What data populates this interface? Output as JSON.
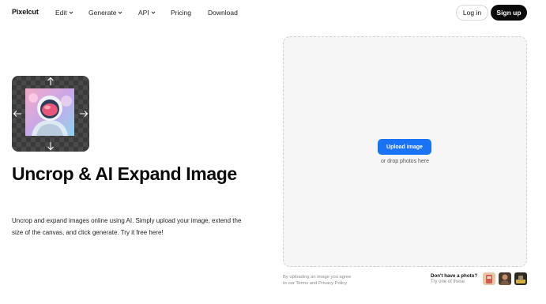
{
  "header": {
    "logo": "Pixelcut",
    "nav": [
      {
        "label": "Edit",
        "dropdown": true
      },
      {
        "label": "Generate",
        "dropdown": true
      },
      {
        "label": "API",
        "dropdown": true
      },
      {
        "label": "Pricing",
        "dropdown": false
      },
      {
        "label": "Download",
        "dropdown": false
      }
    ],
    "login_label": "Log in",
    "signup_label": "Sign up"
  },
  "hero": {
    "title": "Uncrop & AI Expand Image",
    "description": "Uncrop and expand images online using AI. Simply upload your image, extend the size of the canvas, and click generate. Try it free here!",
    "thumb_icons": [
      "arrow-up-icon",
      "arrow-down-icon",
      "arrow-left-icon",
      "arrow-right-icon"
    ]
  },
  "upload": {
    "button_label": "Upload image",
    "hint": "or drop photos here",
    "terms_line1": "By uploading an image you agree",
    "terms_line2": "to our Terms and Privacy Policy",
    "no_photo_title": "Don't have a photo?",
    "no_photo_sub": "Try one of these"
  },
  "colors": {
    "accent": "#1a73f5",
    "signup_bg": "#0a0a0a",
    "dropzone_bg": "#f6f6f6"
  }
}
